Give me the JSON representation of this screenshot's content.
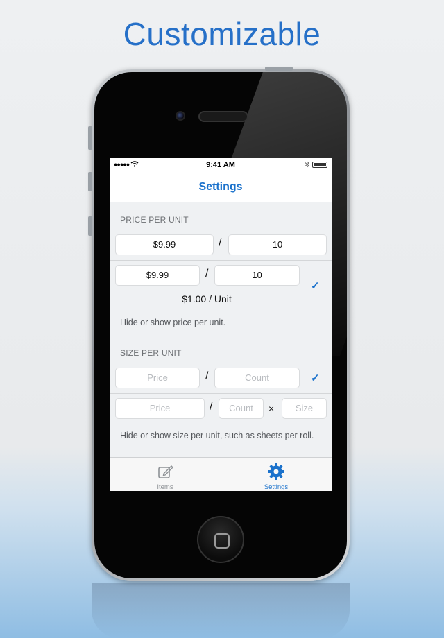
{
  "headline": "Customizable",
  "statusbar": {
    "carrier": "●●●●● ",
    "wifi": "wifi-icon",
    "time": "9:41 AM",
    "bluetooth": "bluetooth-icon",
    "battery": "battery-icon"
  },
  "nav": {
    "title": "Settings"
  },
  "price_section": {
    "header": "PRICE PER UNIT",
    "row1": {
      "price": "$9.99",
      "sep": "/",
      "count": "10"
    },
    "row2": {
      "price": "$9.99",
      "sep": "/",
      "count": "10",
      "result": "$1.00 / Unit",
      "selected": true
    },
    "note": "Hide or show price per unit."
  },
  "size_section": {
    "header": "SIZE PER UNIT",
    "row1": {
      "price_placeholder": "Price",
      "sep": "/",
      "count_placeholder": "Count",
      "selected": true
    },
    "row2": {
      "price_placeholder": "Price",
      "sep": "/",
      "count_placeholder": "Count",
      "times": "×",
      "size_placeholder": "Size"
    },
    "note": "Hide or show size per unit, such as sheets per roll."
  },
  "tabs": [
    {
      "label": "Items",
      "icon": "compose-icon",
      "active": false
    },
    {
      "label": "Settings",
      "icon": "gear-icon",
      "active": true
    }
  ],
  "colors": {
    "accent": "#1b72cc",
    "headline": "#2670c8"
  }
}
